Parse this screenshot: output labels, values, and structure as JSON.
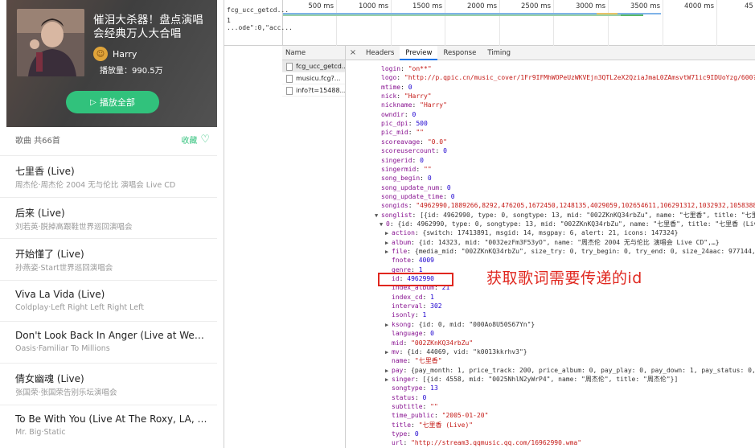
{
  "playlist": {
    "title": "催泪大杀器！盘点演唱会经典万人大合唱",
    "creator": "Harry",
    "play_count": "播放量：990.5万",
    "play_all": "播放全部",
    "song_count": "歌曲 共66首",
    "collect": "收藏"
  },
  "songs": [
    {
      "name": "七里香 (Live)",
      "sub": "周杰伦·周杰伦 2004 无与伦比 演唱会 Live CD"
    },
    {
      "name": "后来 (Live)",
      "sub": "刘若英·脱掉高跟鞋世界巡回演唱会"
    },
    {
      "name": "开始懂了 (Live)",
      "sub": "孙燕姿·Start世界巡回演唱会"
    },
    {
      "name": "Viva La Vida (Live)",
      "sub": "Coldplay·Left Right Left Right Left"
    },
    {
      "name": "Don't Look Back In Anger (Live at Wembley...",
      "sub": "Oasis·Familiar To Millions"
    },
    {
      "name": "倩女幽魂 (Live)",
      "sub": "张国荣·张国荣告别乐坛演唱会"
    },
    {
      "name": "To Be With You (Live At The Roxy, LA, Aug...",
      "sub": "Mr. Big·Static"
    }
  ],
  "devtools": {
    "timeline": {
      "requests": [
        "fcg_ucc_getcd...",
        "1  ...ode\":0,\"acc..."
      ],
      "ticks": [
        "500 ms",
        "1000 ms",
        "1500 ms",
        "2000 ms",
        "2500 ms",
        "3000 ms",
        "3500 ms",
        "4000 ms",
        "45"
      ]
    },
    "names_header": "Name",
    "requests": [
      "fcg_ucc_getcd...",
      "musicu.fcg?...",
      "info?t=15488..."
    ],
    "tabs": [
      "×",
      "Headers",
      "Preview",
      "Response",
      "Timing"
    ],
    "active_tab": "Preview",
    "json_lines": [
      {
        "indent": 0,
        "key": "login",
        "val": "\"on**\"",
        "t": "s"
      },
      {
        "indent": 0,
        "key": "logo",
        "val": "\"http://p.qpic.cn/music_cover/1Fr9IFMhWOPeUzWKVEjn3QTL2eX2QziaJmaL0ZAmsvtW71ic9IDUoYzg/600?n=1\"",
        "t": "s"
      },
      {
        "indent": 0,
        "key": "mtime",
        "val": "0",
        "t": "n"
      },
      {
        "indent": 0,
        "key": "nick",
        "val": "\"Harry\"",
        "t": "s"
      },
      {
        "indent": 0,
        "key": "nickname",
        "val": "\"Harry\"",
        "t": "s"
      },
      {
        "indent": 0,
        "key": "owndir",
        "val": "0",
        "t": "n"
      },
      {
        "indent": 0,
        "key": "pic_dpi",
        "val": "500",
        "t": "n"
      },
      {
        "indent": 0,
        "key": "pic_mid",
        "val": "\"\"",
        "t": "s"
      },
      {
        "indent": 0,
        "key": "scoreavage",
        "val": "\"0.0\"",
        "t": "s"
      },
      {
        "indent": 0,
        "key": "scoreusercount",
        "val": "0",
        "t": "n"
      },
      {
        "indent": 0,
        "key": "singerid",
        "val": "0",
        "t": "n"
      },
      {
        "indent": 0,
        "key": "singermid",
        "val": "\"\"",
        "t": "s"
      },
      {
        "indent": 0,
        "key": "song_begin",
        "val": "0",
        "t": "n"
      },
      {
        "indent": 0,
        "key": "song_update_num",
        "val": "0",
        "t": "n"
      },
      {
        "indent": 0,
        "key": "song_update_time",
        "val": "0",
        "t": "n"
      },
      {
        "indent": 0,
        "key": "songids",
        "val": "\"4962990,1889266,8292,476205,1672450,1248135,4029059,102654611,106291312,1032932,105838893,1",
        "t": "s"
      },
      {
        "indent": 0,
        "arrow": "▼",
        "key": "songlist",
        "val": "[{id: 4962990, type: 0, songtype: 13, mid: \"002ZKnKQ34rbZu\", name: \"七里香\", title: \"七里香",
        "t": "p"
      },
      {
        "indent": 1,
        "arrow": "▼",
        "key": "0",
        "val": "{id: 4962990, type: 0, songtype: 13, mid: \"002ZKnKQ34rbZu\", name: \"七里香\", title: \"七里香 (Live)",
        "t": "p"
      },
      {
        "indent": 2,
        "arrow": "▶",
        "key": "action",
        "val": "{switch: 17413891, msgid: 14, msgpay: 6, alert: 21, icons: 147324}",
        "t": "p"
      },
      {
        "indent": 2,
        "arrow": "▶",
        "key": "album",
        "val": "{id: 14323, mid: \"0032ezFm3F53yO\", name: \"周杰伦 2004 无与伦比 演唱会 Live CD\",…}",
        "t": "p"
      },
      {
        "indent": 2,
        "arrow": "▶",
        "key": "file",
        "val": "{media_mid: \"002ZKnKQ34rbZu\", size_try: 0, try_begin: 0, try_end: 0, size_24aac: 977144,…}",
        "t": "p"
      },
      {
        "indent": 2,
        "key": "fnote",
        "val": "4009",
        "t": "n"
      },
      {
        "indent": 2,
        "key": "genre",
        "val": "1",
        "t": "n"
      },
      {
        "indent": 2,
        "key": "id",
        "val": "4962990",
        "t": "n"
      },
      {
        "indent": 2,
        "key": "index_album",
        "val": "21",
        "t": "n"
      },
      {
        "indent": 2,
        "key": "index_cd",
        "val": "1",
        "t": "n"
      },
      {
        "indent": 2,
        "key": "interval",
        "val": "302",
        "t": "n"
      },
      {
        "indent": 2,
        "key": "isonly",
        "val": "1",
        "t": "n"
      },
      {
        "indent": 2,
        "arrow": "▶",
        "key": "ksong",
        "val": "{id: 0, mid: \"000Ao8U50S67Yn\"}",
        "t": "p"
      },
      {
        "indent": 2,
        "key": "language",
        "val": "0",
        "t": "n"
      },
      {
        "indent": 2,
        "key": "mid",
        "val": "\"002ZKnKQ34rbZu\"",
        "t": "s"
      },
      {
        "indent": 2,
        "arrow": "▶",
        "key": "mv",
        "val": "{id: 44069, vid: \"k0013kkrhv3\"}",
        "t": "p"
      },
      {
        "indent": 2,
        "key": "name",
        "val": "\"七里香\"",
        "t": "s"
      },
      {
        "indent": 2,
        "arrow": "▶",
        "key": "pay",
        "val": "{pay_month: 1, price_track: 200, price_album: 0, pay_play: 0, pay_down: 1, pay_status: 0, ti",
        "t": "p"
      },
      {
        "indent": 2,
        "arrow": "▶",
        "key": "singer",
        "val": "[{id: 4558, mid: \"0025NhlN2yWrP4\", name: \"周杰伦\", title: \"周杰伦\"}]",
        "t": "p"
      },
      {
        "indent": 2,
        "key": "songtype",
        "val": "13",
        "t": "n"
      },
      {
        "indent": 2,
        "key": "status",
        "val": "0",
        "t": "n"
      },
      {
        "indent": 2,
        "key": "subtitle",
        "val": "\"\"",
        "t": "s"
      },
      {
        "indent": 2,
        "key": "time_public",
        "val": "\"2005-01-20\"",
        "t": "s"
      },
      {
        "indent": 2,
        "key": "title",
        "val": "\"七里香 (Live)\"",
        "t": "s"
      },
      {
        "indent": 2,
        "key": "type",
        "val": "0",
        "t": "n"
      },
      {
        "indent": 2,
        "key": "url",
        "val": "\"http://stream3.qqmusic.qq.com/16962990.wma\"",
        "t": "s"
      }
    ]
  },
  "annotation": "获取歌词需要传递的id",
  "colors": {
    "accent": "#31c27c",
    "annotation": "#e0271f"
  }
}
